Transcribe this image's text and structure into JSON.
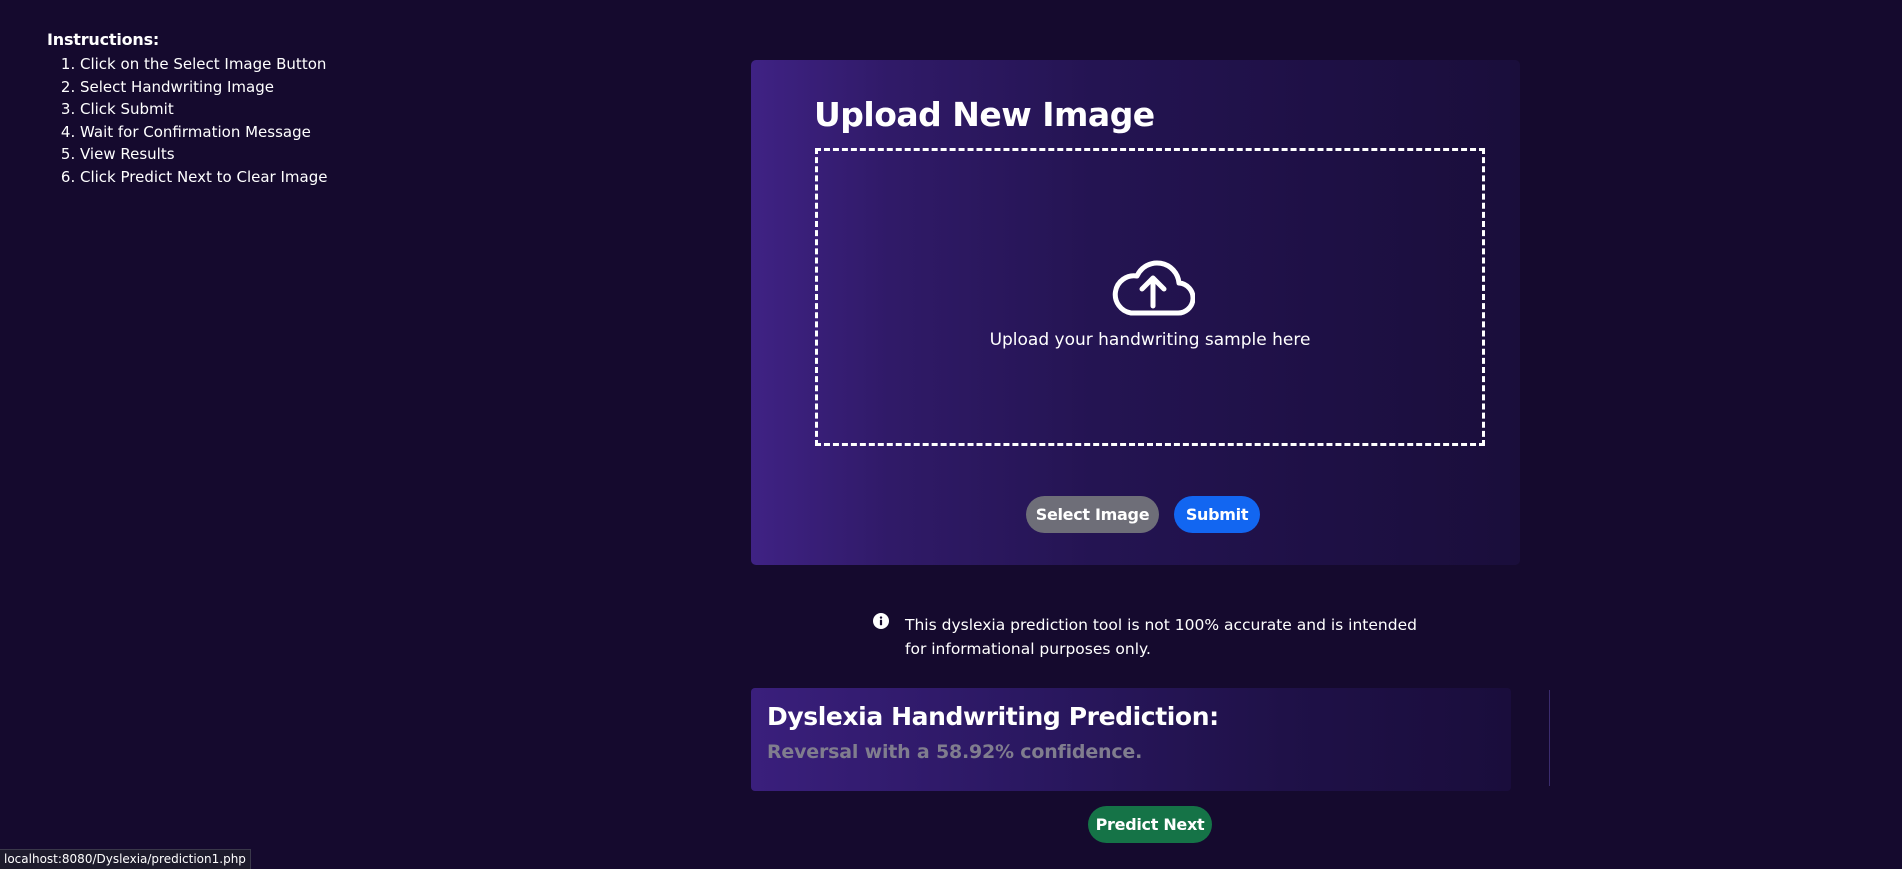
{
  "instructions": {
    "title": "Instructions:",
    "steps": [
      "Click on the Select Image Button",
      "Select Handwriting Image",
      "Click Submit",
      "Wait for Confirmation Message",
      "View Results",
      "Click Predict Next to Clear Image"
    ]
  },
  "upload": {
    "title": "Upload New Image",
    "dropzone_text": "Upload your handwriting sample here",
    "dropzone_icon": "cloud-upload-icon",
    "select_label": "Select Image",
    "submit_label": "Submit"
  },
  "disclaimer": {
    "icon": "info-icon",
    "text": "This dyslexia prediction tool is not 100% accurate and is intended for informational purposes only."
  },
  "result": {
    "title": "Dyslexia Handwriting Prediction:",
    "value": "Reversal with a 58.92% confidence."
  },
  "predict_next_label": "Predict Next",
  "status_url": "localhost:8080/Dyslexia/prediction1.php",
  "colors": {
    "background": "#150a2e",
    "card_gradient_start": "#3f2284",
    "select_button": "#6e6e78",
    "submit_button": "#1266f1",
    "predict_next_button": "#157347",
    "result_text": "#807d8e"
  }
}
